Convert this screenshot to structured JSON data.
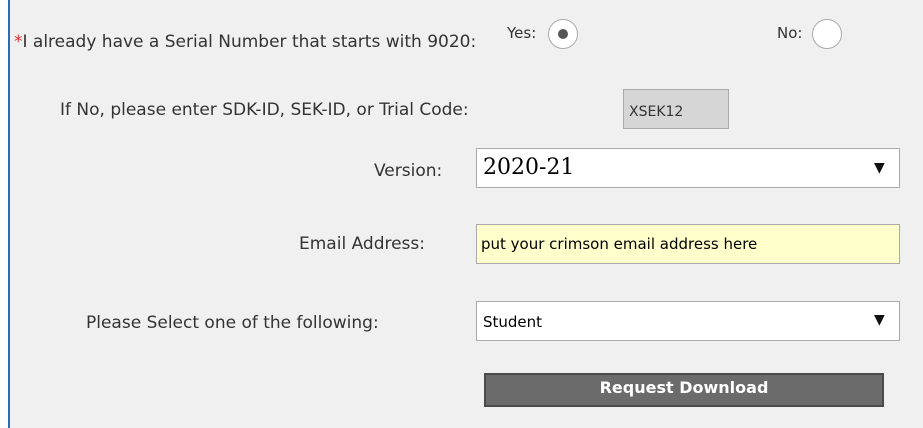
{
  "serial_question": {
    "required_mark": "*",
    "label": "I already have a Serial Number that starts with 9020:",
    "yes_label": "Yes:",
    "no_label": "No:",
    "selected": "Yes"
  },
  "sdk_field": {
    "label": "If No, please enter SDK-ID, SEK-ID, or Trial Code:",
    "value": "XSEK12"
  },
  "version": {
    "label": "Version:",
    "selected": "2020-21"
  },
  "email": {
    "label": "Email Address:",
    "value": "put your crimson email address here"
  },
  "role": {
    "label": "Please Select one of the following:",
    "selected": "Student"
  },
  "submit": {
    "label": "Request Download"
  },
  "colors": {
    "panel_bg": "#f0f0f0",
    "required": "#e03030",
    "email_bg": "#ffffcc",
    "button_bg": "#6b6b6b",
    "disabled_input_bg": "#d6d6d6"
  }
}
